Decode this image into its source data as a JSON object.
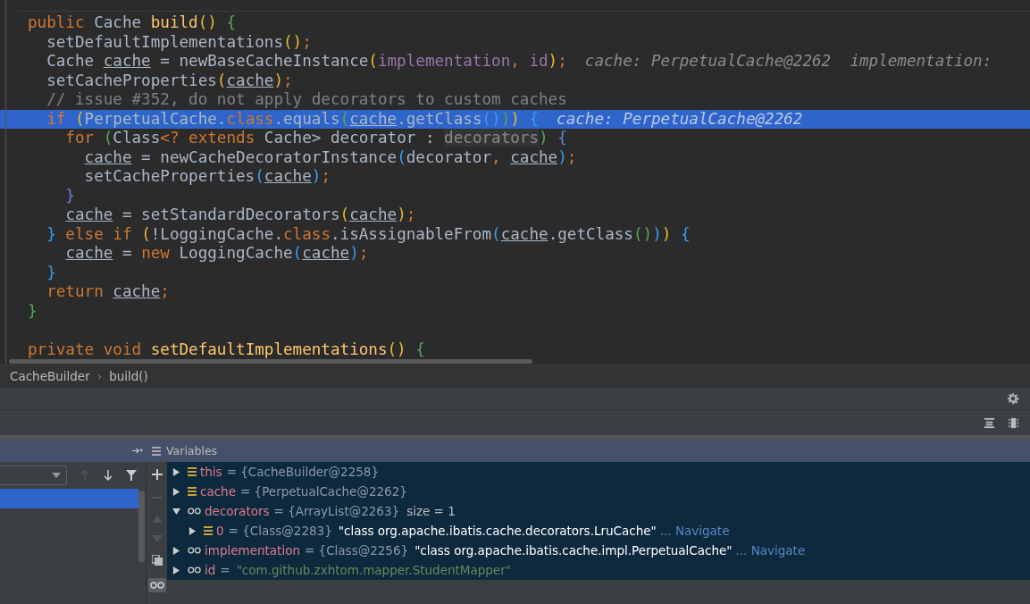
{
  "editor": {
    "lines": [
      {
        "current": false,
        "tokens": [
          {
            "kind": "kw",
            "text": "public"
          },
          {
            "kind": "plain",
            "text": " Cache "
          },
          {
            "kind": "decl",
            "text": "build"
          },
          {
            "kind": "y",
            "text": "() "
          },
          {
            "kind": "g",
            "text": "{"
          }
        ]
      },
      {
        "current": false,
        "tokens": [
          {
            "kind": "plain",
            "text": "  setDefaultImplementations"
          },
          {
            "kind": "y",
            "text": "()"
          },
          {
            "kind": "kw",
            "text": ";"
          }
        ]
      },
      {
        "current": false,
        "hint": "cache: PerpetualCache@2262  implementation:",
        "tokens": [
          {
            "kind": "plain",
            "text": "  Cache "
          },
          {
            "kind": "local",
            "text": "cache"
          },
          {
            "kind": "plain",
            "text": " = newBaseCacheInstance"
          },
          {
            "kind": "y",
            "text": "("
          },
          {
            "kind": "field",
            "text": "implementation"
          },
          {
            "kind": "kw",
            "text": ","
          },
          {
            "kind": "field",
            "text": " id"
          },
          {
            "kind": "y",
            "text": ")"
          },
          {
            "kind": "kw",
            "text": ";"
          }
        ]
      },
      {
        "current": false,
        "tokens": [
          {
            "kind": "plain",
            "text": "  setCacheProperties"
          },
          {
            "kind": "y",
            "text": "("
          },
          {
            "kind": "local",
            "text": "cache"
          },
          {
            "kind": "y",
            "text": ")"
          },
          {
            "kind": "kw",
            "text": ";"
          }
        ]
      },
      {
        "current": false,
        "tokens": [
          {
            "kind": "comment",
            "text": "  // issue #352, do not apply decorators to custom caches"
          }
        ]
      },
      {
        "current": true,
        "hint": "cache: PerpetualCache@2262",
        "tokens": [
          {
            "kind": "kw",
            "text": "  if "
          },
          {
            "kind": "y",
            "text": "("
          },
          {
            "kind": "plain",
            "text": "PerpetualCache."
          },
          {
            "kind": "kw",
            "text": "class"
          },
          {
            "kind": "plain",
            "text": ".equals"
          },
          {
            "kind": "g",
            "text": "("
          },
          {
            "kind": "local",
            "text": "cache"
          },
          {
            "kind": "plain",
            "text": ".getClass"
          },
          {
            "kind": "b",
            "text": "()"
          },
          {
            "kind": "g",
            "text": ")"
          },
          {
            "kind": "y",
            "text": ") "
          },
          {
            "kind": "b",
            "text": "{"
          }
        ]
      },
      {
        "current": false,
        "tokens": [
          {
            "kind": "kw",
            "text": "    for "
          },
          {
            "kind": "g",
            "text": "("
          },
          {
            "kind": "plain",
            "text": "Class"
          },
          {
            "kind": "kw",
            "text": "<? extends"
          },
          {
            "kind": "plain",
            "text": " Cache> decorator : "
          },
          {
            "kind": "dim",
            "text": "decorators"
          },
          {
            "kind": "g",
            "text": ") "
          },
          {
            "kind": "p",
            "text": "{"
          }
        ]
      },
      {
        "current": false,
        "tokens": [
          {
            "kind": "local",
            "text": "      cache"
          },
          {
            "kind": "plain",
            "text": " = newCacheDecoratorInstance"
          },
          {
            "kind": "b",
            "text": "("
          },
          {
            "kind": "plain",
            "text": "decorator"
          },
          {
            "kind": "kw",
            "text": ", "
          },
          {
            "kind": "local",
            "text": "cache"
          },
          {
            "kind": "b",
            "text": ")"
          },
          {
            "kind": "kw",
            "text": ";"
          }
        ]
      },
      {
        "current": false,
        "tokens": [
          {
            "kind": "plain",
            "text": "      setCacheProperties"
          },
          {
            "kind": "b",
            "text": "("
          },
          {
            "kind": "local",
            "text": "cache"
          },
          {
            "kind": "b",
            "text": ")"
          },
          {
            "kind": "kw",
            "text": ";"
          }
        ]
      },
      {
        "current": false,
        "tokens": [
          {
            "kind": "p",
            "text": "    }"
          }
        ]
      },
      {
        "current": false,
        "tokens": [
          {
            "kind": "local",
            "text": "    cache"
          },
          {
            "kind": "plain",
            "text": " = setStandardDecorators"
          },
          {
            "kind": "y",
            "text": "("
          },
          {
            "kind": "local",
            "text": "cache"
          },
          {
            "kind": "y",
            "text": ")"
          },
          {
            "kind": "kw",
            "text": ";"
          }
        ]
      },
      {
        "current": false,
        "tokens": [
          {
            "kind": "b",
            "text": "  }"
          },
          {
            "kind": "kw",
            "text": " else if "
          },
          {
            "kind": "y",
            "text": "("
          },
          {
            "kind": "plain",
            "text": "!LoggingCache."
          },
          {
            "kind": "kw",
            "text": "class"
          },
          {
            "kind": "plain",
            "text": ".isAssignableFrom"
          },
          {
            "kind": "b",
            "text": "("
          },
          {
            "kind": "local",
            "text": "cache"
          },
          {
            "kind": "plain",
            "text": ".getClass"
          },
          {
            "kind": "g",
            "text": "()"
          },
          {
            "kind": "b",
            "text": ")"
          },
          {
            "kind": "y",
            "text": ") "
          },
          {
            "kind": "b",
            "text": "{"
          }
        ]
      },
      {
        "current": false,
        "tokens": [
          {
            "kind": "local",
            "text": "    cache"
          },
          {
            "kind": "plain",
            "text": " = "
          },
          {
            "kind": "kw",
            "text": "new"
          },
          {
            "kind": "plain",
            "text": " LoggingCache"
          },
          {
            "kind": "b",
            "text": "("
          },
          {
            "kind": "local",
            "text": "cache"
          },
          {
            "kind": "b",
            "text": ")"
          },
          {
            "kind": "kw",
            "text": ";"
          }
        ]
      },
      {
        "current": false,
        "tokens": [
          {
            "kind": "b",
            "text": "  }"
          }
        ]
      },
      {
        "current": false,
        "tokens": [
          {
            "kind": "kw",
            "text": "  return "
          },
          {
            "kind": "local",
            "text": "cache"
          },
          {
            "kind": "kw",
            "text": ";"
          }
        ]
      },
      {
        "current": false,
        "tokens": [
          {
            "kind": "g",
            "text": "}"
          }
        ]
      },
      {
        "current": false
      },
      {
        "current": false,
        "tokens": [
          {
            "kind": "kw",
            "text": "private void "
          },
          {
            "kind": "decl",
            "text": "setDefaultImplementations"
          },
          {
            "kind": "y",
            "text": "() "
          },
          {
            "kind": "g",
            "text": "{"
          }
        ]
      }
    ]
  },
  "breadcrumb": {
    "separator": "›",
    "items": [
      "CacheBuilder",
      "build()"
    ]
  },
  "variables": {
    "title": "Variables",
    "items": [
      {
        "kind": "field",
        "expanded": false,
        "name": "this",
        "value": "= {CacheBuilder@2258}"
      },
      {
        "kind": "field",
        "expanded": false,
        "name": "cache",
        "value": "= {PerpetualCache@2262}"
      },
      {
        "kind": "watch",
        "expanded": true,
        "name": "decorators",
        "value": "= {ArrayList@2263}",
        "extra": "size = 1",
        "children": [
          {
            "kind": "field",
            "expanded": false,
            "name": "0",
            "value": "= {Class@2283}",
            "string": "\"class org.apache.ibatis.cache.decorators.LruCache\"",
            "link": "... Navigate"
          }
        ]
      },
      {
        "kind": "watch",
        "expanded": false,
        "name": "implementation",
        "value": "= {Class@2256}",
        "string": "\"class org.apache.ibatis.cache.impl.PerpetualCache\"",
        "link": "... Navigate"
      },
      {
        "kind": "string",
        "expanded": false,
        "name": "id",
        "value": "=",
        "string": "\"com.github.zxhtom.mapper.StudentMapper\""
      }
    ]
  }
}
